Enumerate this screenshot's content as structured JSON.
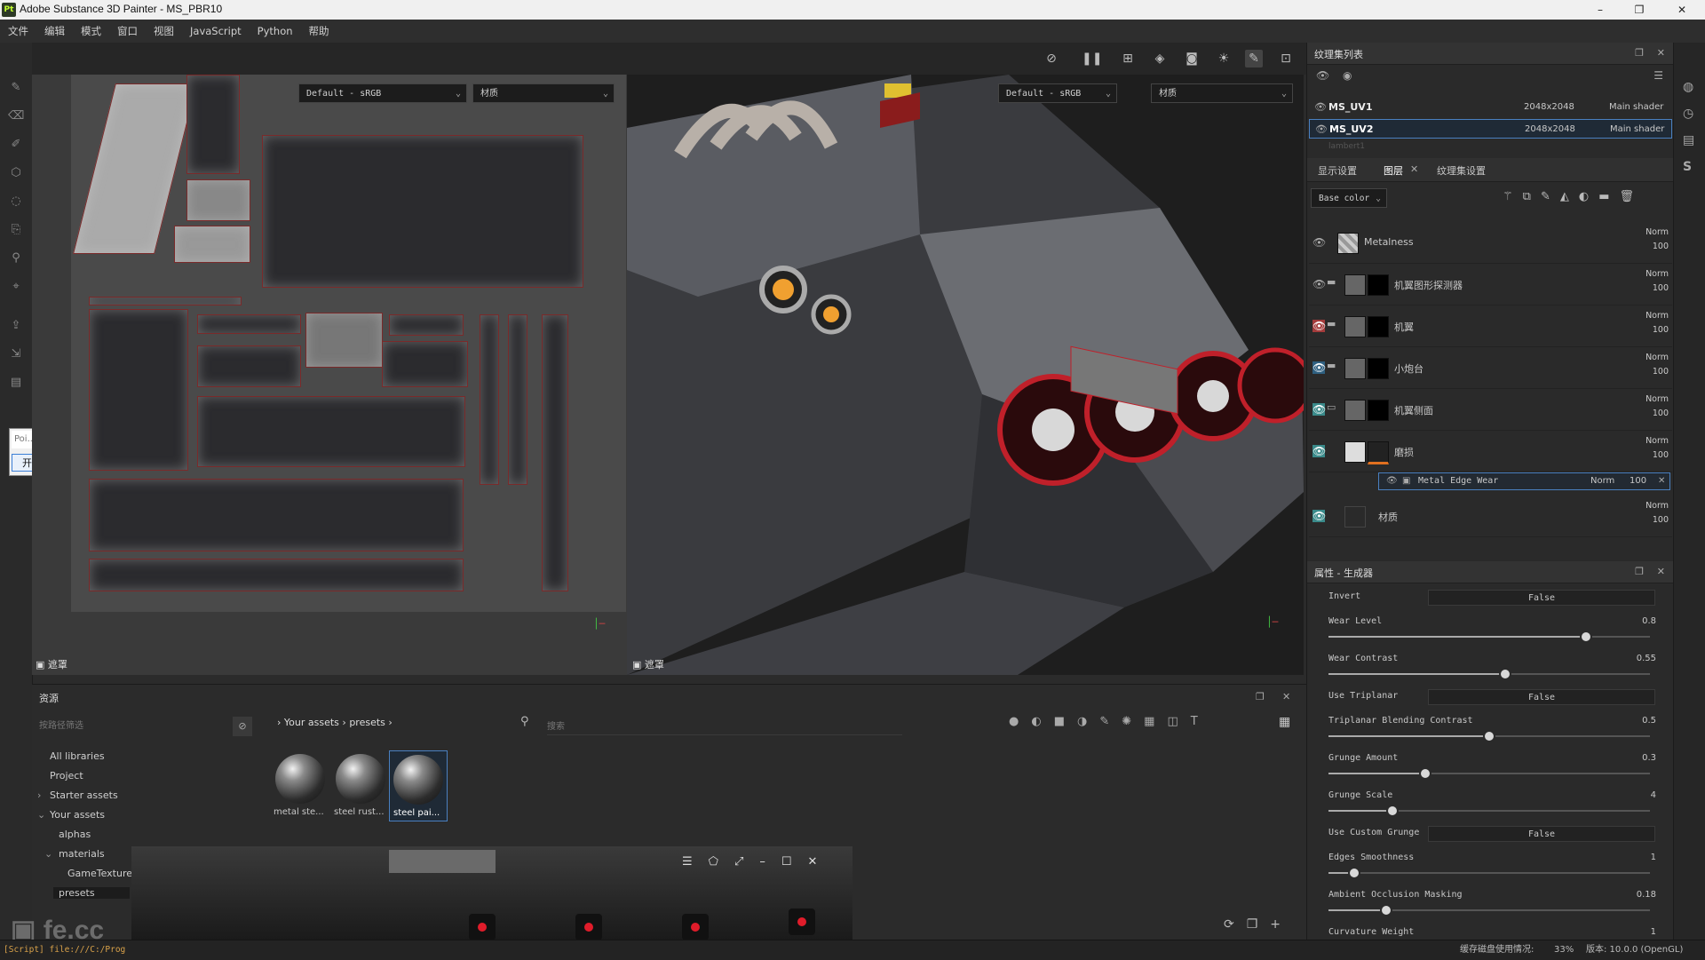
{
  "window": {
    "title": "Adobe Substance 3D Painter - MS_PBR10",
    "logo_text": "Pt",
    "minimize": "–",
    "maximize": "❐",
    "close": "✕"
  },
  "menu": [
    "文件",
    "编辑",
    "模式",
    "窗口",
    "视图",
    "JavaScript",
    "Python",
    "帮助"
  ],
  "uv_view": {
    "colorspace": "Default - sRGB",
    "channel": "材质",
    "mask_label": "遮罩"
  },
  "viewport3d": {
    "colorspace": "Default - sRGB",
    "channel": "材质",
    "mask_label": "遮罩"
  },
  "left_popup": {
    "input_text": "Poi...",
    "button": "开始"
  },
  "texture_set_list": {
    "title": "纹理集列表",
    "sets": [
      {
        "name": "MS_UV1",
        "size": "2048x2048",
        "shader": "Main shader"
      },
      {
        "name": "MS_UV2",
        "size": "2048x2048",
        "shader": "Main shader"
      }
    ],
    "partial": "lambert1"
  },
  "layers_panel": {
    "tabs": [
      "显示设置",
      "图层",
      "纹理集设置"
    ],
    "channel": "Base color",
    "layers": [
      {
        "name": "Metalness",
        "blend": "Norm",
        "opacity": "100"
      },
      {
        "name": "机翼图形探测器",
        "blend": "Norm",
        "opacity": "100"
      },
      {
        "name": "机翼",
        "blend": "Norm",
        "opacity": "100"
      },
      {
        "name": "小炮台",
        "blend": "Norm",
        "opacity": "100"
      },
      {
        "name": "机翼侧面",
        "blend": "Norm",
        "opacity": "100"
      },
      {
        "name": "磨损",
        "blend": "Norm",
        "opacity": "100"
      },
      {
        "name": "材质",
        "blend": "Norm",
        "opacity": "100"
      }
    ],
    "effect": {
      "name": "Metal Edge Wear",
      "blend": "Norm",
      "opacity": "100"
    }
  },
  "properties": {
    "title": "属性 - 生成器",
    "items": [
      {
        "label": "Invert",
        "kind": "toggle",
        "value": "False"
      },
      {
        "label": "Wear Level",
        "kind": "slider",
        "value": "0.8",
        "fraction": 0.8
      },
      {
        "label": "Wear Contrast",
        "kind": "slider",
        "value": "0.55",
        "fraction": 0.55
      },
      {
        "label": "Use Triplanar",
        "kind": "toggle",
        "value": "False"
      },
      {
        "label": "Triplanar Blending Contrast",
        "kind": "slider",
        "value": "0.5",
        "fraction": 0.5
      },
      {
        "label": "Grunge Amount",
        "kind": "slider",
        "value": "0.3",
        "fraction": 0.3
      },
      {
        "label": "Grunge Scale",
        "kind": "slider",
        "value": "4",
        "fraction": 0.2
      },
      {
        "label": "Use Custom Grunge",
        "kind": "toggle",
        "value": "False"
      },
      {
        "label": "Edges Smoothness",
        "kind": "slider",
        "value": "1",
        "fraction": 0.08
      },
      {
        "label": "Ambient Occlusion Masking",
        "kind": "slider",
        "value": "0.18",
        "fraction": 0.18
      },
      {
        "label": "Curvature Weight",
        "kind": "slider",
        "value": "1",
        "fraction": 1.0
      }
    ]
  },
  "assets": {
    "title": "资源",
    "filter_placeholder": "按路径筛选",
    "search_placeholder": "搜索",
    "breadcrumb": [
      "Your assets",
      "presets"
    ],
    "tree": [
      "All libraries",
      "Project",
      "Starter assets",
      "Your assets",
      "alphas",
      "materials",
      "GameTextures",
      "presets"
    ],
    "items": [
      "metal ste...",
      "steel rust...",
      "steel pai..."
    ]
  },
  "statusbar": {
    "left": "[Script] file:///C:/Prog",
    "cache": "缓存磁盘使用情况:",
    "cache_value": "33%",
    "version": "版本: 10.0.0 (OpenGL)"
  },
  "watermark": "fe.cc",
  "colors": {
    "accent_red": "#c0202a",
    "bg": "#2b2b2b",
    "eye_red": "#a33b3b",
    "eye_teal": "#3a8a8a"
  }
}
